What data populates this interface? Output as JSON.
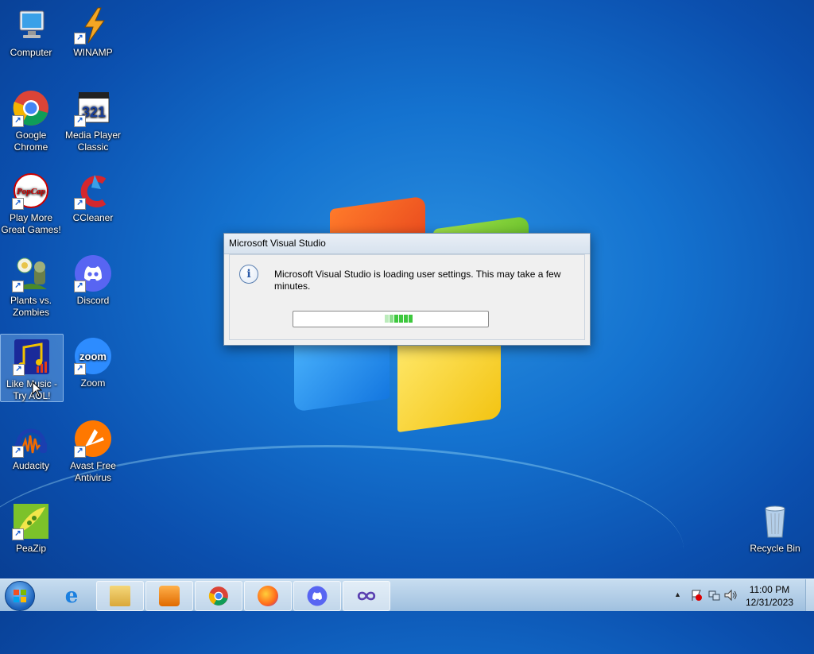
{
  "desktop": {
    "icons": [
      {
        "label": "Computer",
        "icon": "computer-icon"
      },
      {
        "label": "WINAMP",
        "icon": "winamp-icon"
      },
      {
        "label": "Google Chrome",
        "icon": "chrome-icon"
      },
      {
        "label": "Media Player Classic",
        "icon": "mpc-icon"
      },
      {
        "label": "Play More Great Games!",
        "icon": "popcap-icon"
      },
      {
        "label": "CCleaner",
        "icon": "ccleaner-icon"
      },
      {
        "label": "Plants vs. Zombies",
        "icon": "pvz-icon"
      },
      {
        "label": "Discord",
        "icon": "discord-icon"
      },
      {
        "label": "Like Music - Try AOL!",
        "icon": "aol-music-icon"
      },
      {
        "label": "Zoom",
        "icon": "zoom-icon"
      },
      {
        "label": "Audacity",
        "icon": "audacity-icon"
      },
      {
        "label": "Avast Free Antivirus",
        "icon": "avast-icon"
      },
      {
        "label": "PeaZip",
        "icon": "peazip-icon"
      },
      {
        "label": "Recycle Bin",
        "icon": "recycle-bin-icon"
      }
    ],
    "zoom_icon_text": "zoom",
    "mpc_icon_text": "321",
    "popcap_icon_text": "PopCap"
  },
  "dialog": {
    "title": "Microsoft Visual Studio",
    "message": "Microsoft Visual Studio is loading user settings. This may take a few minutes.",
    "icon": "info-icon",
    "info_glyph": "i"
  },
  "taskbar": {
    "pinned": [
      {
        "name": "Internet Explorer",
        "icon": "ie-icon"
      },
      {
        "name": "Windows Explorer",
        "icon": "explorer-icon"
      },
      {
        "name": "Windows Media Player",
        "icon": "media-player-icon"
      },
      {
        "name": "Google Chrome",
        "icon": "chrome-icon"
      },
      {
        "name": "Firefox",
        "icon": "firefox-icon"
      },
      {
        "name": "Discord",
        "icon": "discord-icon"
      },
      {
        "name": "Visual Studio",
        "icon": "visual-studio-icon"
      }
    ],
    "clock_time": "11:00 PM",
    "clock_date": "12/31/2023",
    "tray_arrow": "▲",
    "ie_glyph": "e"
  },
  "colors": {
    "desktop_blue": "#1472cf",
    "progress_green": "#3ec83e",
    "taskbar": "#b7d1ea"
  }
}
